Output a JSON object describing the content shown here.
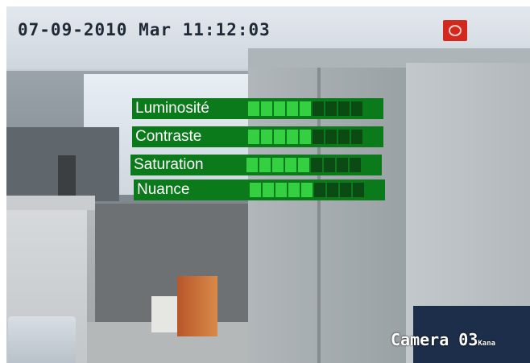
{
  "overlay": {
    "datetime": "07-09-2010 Mar 11:12:03",
    "camera_label": "Camera 03",
    "camera_suffix": "Kana"
  },
  "menu": {
    "items": [
      {
        "label": "Luminosité",
        "level": 0.56
      },
      {
        "label": "Contraste",
        "level": 0.56
      },
      {
        "label": "Saturation",
        "level": 0.5
      },
      {
        "label": "Nuance",
        "level": 0.56
      }
    ],
    "segments": 9
  },
  "icons": {
    "record": "record-indicator-icon"
  },
  "colors": {
    "menu_bg": "#0a7a1a",
    "bar_on": "#35d042",
    "bar_off": "#0b4a12",
    "record": "#d2281e"
  }
}
